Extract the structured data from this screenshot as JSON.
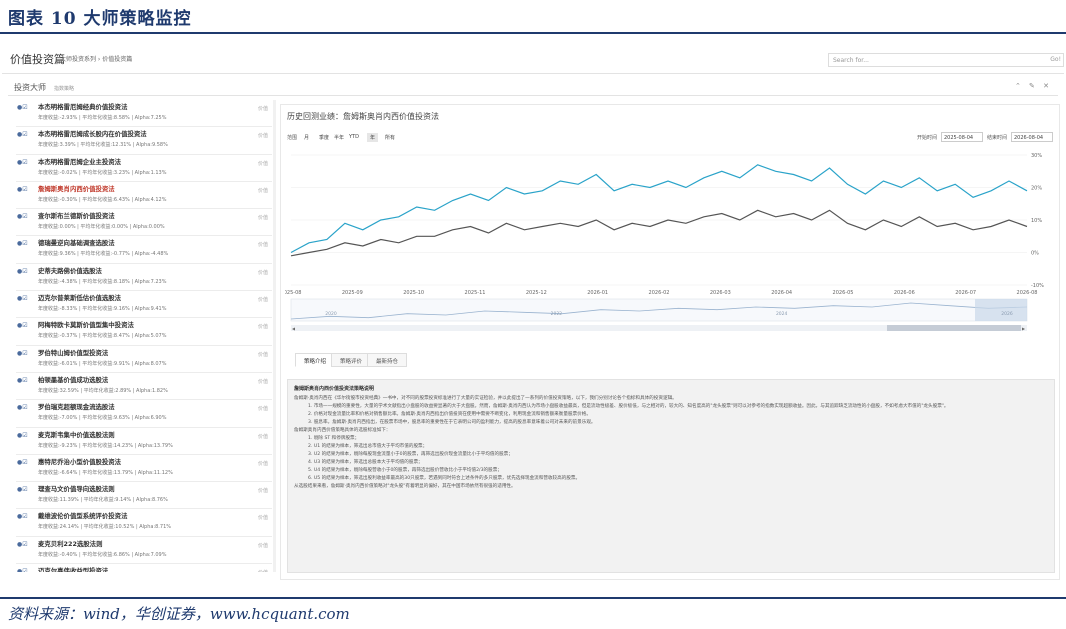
{
  "figure": {
    "title": "图表 10 大师策略监控",
    "source": "资料来源：wind，华创证券，www.hcquant.com"
  },
  "topbar": {
    "page_title": "价值投资篇",
    "breadcrumb": "大师投资系列 › 价值投资篇",
    "search_placeholder": "Search for...",
    "search_go": "Go!"
  },
  "panel": {
    "title": "投资大师",
    "subtitle": "指数策略",
    "controls": "⌃ ✎ ✕"
  },
  "strategies": [
    {
      "name": "本杰明格雷厄姆经典价值投资法",
      "stats": "年度收益:-2.93% | 平均年化收益:8.58% | Alpha:7.25%",
      "tag": "价值",
      "active": false
    },
    {
      "name": "本杰明格雷厄姆成长股内在价值投资法",
      "stats": "年度收益:3.39% | 平均年化收益:12.31% | Alpha:9.58%",
      "tag": "价值",
      "active": false
    },
    {
      "name": "本杰明格雷厄姆企业主投资法",
      "stats": "年度收益:-0.02% | 平均年化收益:3.23% | Alpha:1.13%",
      "tag": "价值",
      "active": false
    },
    {
      "name": "詹姆斯奥肖内西价值投资法",
      "stats": "年度收益:-0.30% | 平均年化收益:6.43% | Alpha:4.12%",
      "tag": "价值",
      "active": true
    },
    {
      "name": "查尔斯布兰德斯价值投资法",
      "stats": "年度收益:0.00% | 平均年化收益:0.00% | Alpha:0.00%",
      "tag": "价值",
      "active": false
    },
    {
      "name": "德瑞曼逆向基础调查选股法",
      "stats": "年度收益:9.36% | 平均年化收益:-0.77% | Alpha:-4.48%",
      "tag": "价值",
      "active": false
    },
    {
      "name": "史蒂夫路佛价值选股法",
      "stats": "年度收益:-4.38% | 平均年化收益:8.18% | Alpha:7.23%",
      "tag": "价值",
      "active": false
    },
    {
      "name": "迈克尔普莱斯低估价值选股法",
      "stats": "年度收益:-8.33% | 平均年化收益:9.16% | Alpha:9.41%",
      "tag": "价值",
      "active": false
    },
    {
      "name": "阿梅特欧卡莫斯价值型集中投资法",
      "stats": "年度收益:-0.37% | 平均年化收益:8.47% | Alpha:5.07%",
      "tag": "价值",
      "active": false
    },
    {
      "name": "罗伯特山姆价值型投资法",
      "stats": "年度收益:-6.01% | 平均年化收益:9.91% | Alpha:8.07%",
      "tag": "价值",
      "active": false
    },
    {
      "name": "柏顿墨基价值成功选股法",
      "stats": "年度收益:32.59% | 平均年化收益:2.89% | Alpha:1.82%",
      "tag": "价值",
      "active": false
    },
    {
      "name": "罗伯瑞克超额现金流选股法",
      "stats": "年度收益:-7.00% | 平均年化收益:9.63% | Alpha:6.90%",
      "tag": "价值",
      "active": false
    },
    {
      "name": "麦克斯韦集中价值选股法则",
      "stats": "年度收益:-9.23% | 平均年化收益:14.23% | Alpha:13.79%",
      "tag": "价值",
      "active": false
    },
    {
      "name": "惠特尼乔治小型价值股投资法",
      "stats": "年度收益:-6.64% | 平均年化收益:13.79% | Alpha:11.12%",
      "tag": "价值",
      "active": false
    },
    {
      "name": "理查马文价值导向选股法则",
      "stats": "年度收益:11.39% | 平均年化收益:9.14% | Alpha:8.76%",
      "tag": "价值",
      "active": false
    },
    {
      "name": "戴维波伦价值型系统评价投资法",
      "stats": "年度收益:24.14% | 平均年化收益:10.52% | Alpha:8.71%",
      "tag": "价值",
      "active": false
    },
    {
      "name": "麦克贝利222选股法则",
      "stats": "年度收益:-0.40% | 平均年化收益:6.86% | Alpha:7.09%",
      "tag": "价值",
      "active": false
    },
    {
      "name": "迈克尔喜伟收益型投资法",
      "stats": "年度收益:-16.37% | 平均年化收益:9.25% | Alpha:6.24%",
      "tag": "价值",
      "active": false
    }
  ],
  "main": {
    "title_prefix": "历史回测业绩：",
    "title_name": "詹姆斯奥肖内西价值投资法",
    "range_label": "范围",
    "ranges": [
      "月",
      "季度",
      "半年",
      "YTD",
      "年",
      "所有"
    ],
    "active_range": "年",
    "start_label": "开始时间",
    "start_value": "2025-08-04",
    "end_label": "结束时间",
    "end_value": "2026-08-04",
    "tabs": [
      "策略介绍",
      "策略评价",
      "最新持仓"
    ],
    "active_tab": "策略介绍"
  },
  "chart_data": {
    "type": "line",
    "x_ticks": [
      "2025-08",
      "2025-09",
      "2025-10",
      "2025-11",
      "2025-12",
      "2026-01",
      "2026-02",
      "2026-03",
      "2026-04",
      "2026-05",
      "2026-06",
      "2026-07",
      "2026-08"
    ],
    "y_ticks": [
      "-10%",
      "0%",
      "10%",
      "20%",
      "30%"
    ],
    "ylim": [
      -10,
      30
    ],
    "series": [
      {
        "color": "#2aa3c9",
        "values": [
          0,
          3,
          4,
          9,
          7,
          10,
          11,
          14,
          13,
          16,
          18,
          16,
          20,
          18,
          19,
          22,
          21,
          24,
          19,
          21,
          20,
          22,
          20,
          23,
          25,
          23,
          27,
          25,
          24,
          22,
          26,
          21,
          18,
          22,
          20,
          23,
          19,
          21,
          17,
          19,
          22,
          19
        ]
      },
      {
        "color": "#555555",
        "values": [
          -1,
          0,
          1,
          3,
          2,
          4,
          3,
          5,
          5,
          7,
          8,
          6,
          9,
          7,
          8,
          9,
          8,
          10,
          7,
          9,
          8,
          10,
          9,
          11,
          12,
          10,
          13,
          11,
          12,
          10,
          13,
          9,
          7,
          10,
          8,
          11,
          8,
          9,
          7,
          8,
          10,
          8
        ]
      }
    ],
    "navigator": {
      "x_ticks": [
        "2020",
        "2022",
        "2024",
        "2026"
      ],
      "values": [
        0,
        2,
        1,
        4,
        3,
        6,
        5,
        4,
        7,
        6,
        8,
        7,
        9,
        8,
        10,
        9,
        12,
        10,
        8,
        9
      ]
    },
    "grid": true,
    "legend": "none"
  },
  "description": {
    "heading": "詹姆斯奥肖内西价值投资法策略说明",
    "intro": "詹姆斯·奥肖内西在《华尔街股市投资经典》一书中，对不同的股票投资标准进行了大量的实证检验，并以此提出了一系列的价值投资策略，以下，我们分别讨论各个指标和具体的投资逻辑。",
    "points": [
      "1. 市场一一规模的重要性，大量的学术文献指出小盘股的收益要显著的大于大盘股。然而，詹姆斯·奥肖内西认为市场小盘股收益最高，但是流动性极差、股价极低，与之相对的，较大的、知名度高的\"龙头股票\"则可以对参考的指数实现超额收益。因此，与其追踪缺乏流动性的小盘股，不如考虑大市值的\"龙头股票\"。",
      "2. 价格对现金流量比率和价格对销售额比率。詹姆斯·奥肖内西指出价值投资在使用中需要不断变化，利用现金流和销售额来衡量股票价格。",
      "3. 股息率。詹姆斯·奥肖内西指出，在股票市场中，股息率的重要性在于它表明公司的盈利能力，提高的股息率意味着公司对未来的前景乐观。"
    ],
    "rule_intro": "詹姆斯奥肖内西价值策略具体的选股标准如下：",
    "rules": [
      "1. 剔除 ST 和停牌股票；",
      "2. U1 的结果为样本，筛选出总市值大于平均市值的股票；",
      "3. U2 的结果为样本，剔除每股现金流量小于0的股票，再筛选出股价现金流量比小于平均值的股票；",
      "4. U3 的结果为样本，筛选出总股本大于平均值的股票；",
      "5. U4 的结果为样本，剔除每股营收小于0的股票，再筛选出股价营收比小于平均值2/3的股票；",
      "6. U5 的结果为样本，筛选出股利收益率最高的30只股票，若遇到同时符合上述条件的多只股票，优先选择现金流和营收较高的股票。"
    ],
    "outro": "从选股结果来看，詹姆斯·奥肖内西价值策略对\"龙头股\"有着明显的偏好，其在中国市场依然有很强的适用性。"
  }
}
